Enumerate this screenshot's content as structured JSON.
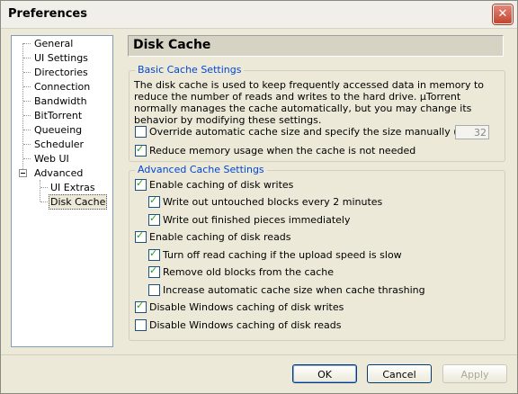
{
  "window": {
    "title": "Preferences"
  },
  "tree": {
    "items": [
      "General",
      "UI Settings",
      "Directories",
      "Connection",
      "Bandwidth",
      "BitTorrent",
      "Queueing",
      "Scheduler",
      "Web UI",
      "Advanced"
    ],
    "children": [
      "UI Extras",
      "Disk Cache"
    ],
    "selected": "Disk Cache"
  },
  "panel": {
    "title": "Disk Cache"
  },
  "basic": {
    "label": "Basic Cache Settings",
    "description": "The disk cache is used to keep frequently accessed data in memory to reduce the number of reads and writes to the hard drive. µTorrent normally manages the cache automatically, but you may change its behavior by modifying these settings.",
    "override_label": "Override automatic cache size and specify the size manually (MB):",
    "override_checked": false,
    "cache_size": "32",
    "reduce_label": "Reduce memory usage when the cache is not needed",
    "reduce_checked": true
  },
  "advanced": {
    "label": "Advanced Cache Settings",
    "options": [
      {
        "label": "Enable caching of disk writes",
        "checked": true
      },
      {
        "label": "Write out untouched blocks every 2 minutes",
        "checked": true
      },
      {
        "label": "Write out finished pieces immediately",
        "checked": true
      },
      {
        "label": "Enable caching of disk reads",
        "checked": true
      },
      {
        "label": "Turn off read caching if the upload speed is slow",
        "checked": true
      },
      {
        "label": "Remove old blocks from the cache",
        "checked": true
      },
      {
        "label": "Increase automatic cache size when cache thrashing",
        "checked": false
      },
      {
        "label": "Disable Windows caching of disk writes",
        "checked": true
      },
      {
        "label": "Disable Windows caching of disk reads",
        "checked": false
      }
    ]
  },
  "buttons": {
    "ok": "OK",
    "cancel": "Cancel",
    "apply": "Apply"
  }
}
